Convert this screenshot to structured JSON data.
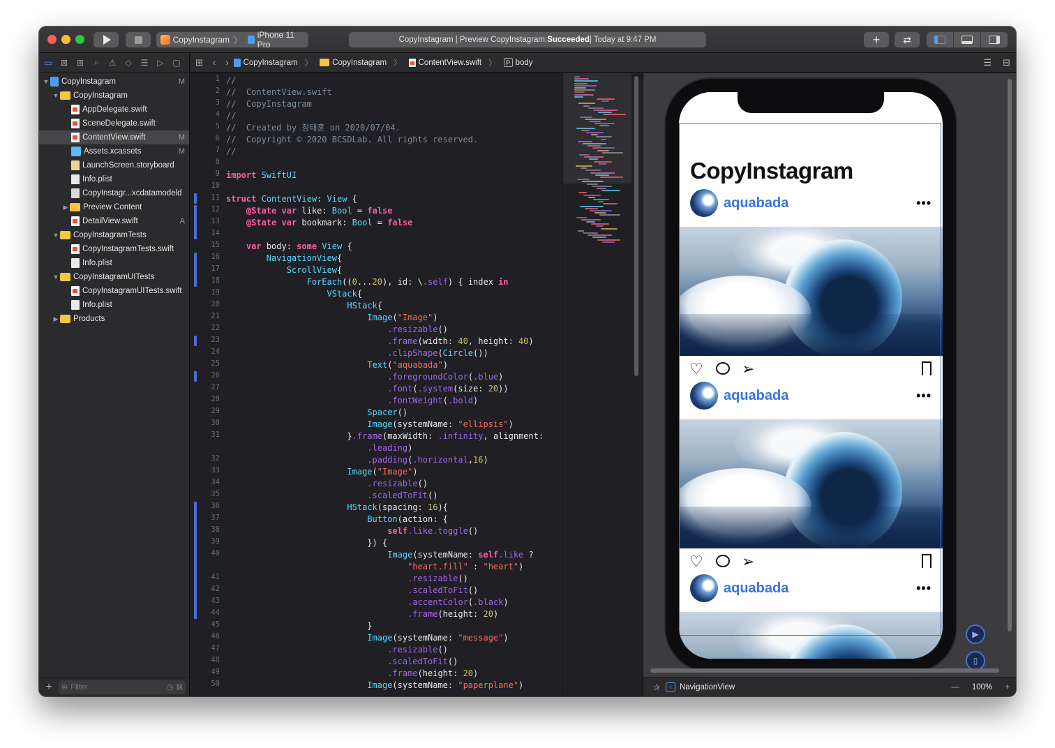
{
  "toolbar": {
    "scheme": "CopyInstagram",
    "device": "iPhone 11 Pro",
    "activity_prefix": "CopyInstagram | Preview CopyInstagram: ",
    "activity_status": "Succeeded",
    "activity_suffix": " | Today at 9:47 PM"
  },
  "navigator": {
    "items": [
      {
        "label": "CopyInstagram",
        "badge": "M"
      },
      {
        "label": "CopyInstagram",
        "badge": ""
      },
      {
        "label": "AppDelegate.swift",
        "badge": ""
      },
      {
        "label": "SceneDelegate.swift",
        "badge": ""
      },
      {
        "label": "ContentView.swift",
        "badge": "M"
      },
      {
        "label": "Assets.xcassets",
        "badge": "M"
      },
      {
        "label": "LaunchScreen.storyboard",
        "badge": ""
      },
      {
        "label": "Info.plist",
        "badge": ""
      },
      {
        "label": "CopyInstagr...xcdatamodeld",
        "badge": ""
      },
      {
        "label": "Preview Content",
        "badge": ""
      },
      {
        "label": "DetailView.swift",
        "badge": "A"
      },
      {
        "label": "CopyInstagramTests",
        "badge": ""
      },
      {
        "label": "CopyInstagramTests.swift",
        "badge": ""
      },
      {
        "label": "Info.plist",
        "badge": ""
      },
      {
        "label": "CopyInstagramUITests",
        "badge": ""
      },
      {
        "label": "CopyInstagramUITests.swift",
        "badge": ""
      },
      {
        "label": "Info.plist",
        "badge": ""
      },
      {
        "label": "Products",
        "badge": ""
      }
    ],
    "filter_placeholder": "Filter"
  },
  "jumpbar": {
    "crumbs": [
      "CopyInstagram",
      "CopyInstagram",
      "ContentView.swift",
      "body"
    ],
    "symbol_glyph": "P"
  },
  "editor": {
    "line_numbers": [
      "1",
      "2",
      "3",
      "4",
      "5",
      "6",
      "7",
      "8",
      "9",
      "10",
      "11",
      "12",
      "13",
      "14",
      "15",
      "16",
      "17",
      "18",
      "19",
      "20",
      "21",
      "22",
      "23",
      "24",
      "25",
      "26",
      "27",
      "28",
      "29",
      "30",
      "31",
      "",
      "32",
      "33",
      "34",
      "35",
      "36",
      "37",
      "38",
      "39",
      "40",
      "",
      "41",
      "42",
      "43",
      "44",
      "45",
      "46",
      "47",
      "48",
      "49",
      "50"
    ],
    "lines": [
      "//",
      "//  ContentView.swift",
      "//  CopyInstagram",
      "//",
      "//  Created by 정태훈 on 2020/07/04.",
      "//  Copyright © 2020 BCSDLab. All rights reserved.",
      "//",
      "",
      "import SwiftUI",
      "",
      "struct ContentView: View {",
      "    @State var like: Bool = false",
      "    @State var bookmark: Bool = false",
      "",
      "    var body: some View {",
      "        NavigationView{",
      "            ScrollView{",
      "                ForEach((0...20), id: \\.self) { index in",
      "                    VStack{",
      "                        HStack{",
      "                            Image(\"Image\")",
      "                                .resizable()",
      "                                .frame(width: 40, height: 40)",
      "                                .clipShape(Circle())",
      "                            Text(\"aquabada\")",
      "                                .foregroundColor(.blue)",
      "                                .font(.system(size: 20))",
      "                                .fontWeight(.bold)",
      "                            Spacer()",
      "                            Image(systemName: \"ellipsis\")",
      "                        }.frame(maxWidth: .infinity, alignment:",
      "                            .leading)",
      "                            .padding(.horizontal,16)",
      "                        Image(\"Image\")",
      "                            .resizable()",
      "                            .scaledToFit()",
      "                        HStack(spacing: 16){",
      "                            Button(action: {",
      "                                self.like.toggle()",
      "                            }) {",
      "                                Image(systemName: self.like ?",
      "                                    \"heart.fill\" : \"heart\")",
      "                                    .resizable()",
      "                                    .scaledToFit()",
      "                                    .accentColor(.black)",
      "                                    .frame(height: 20)",
      "                            }",
      "                            Image(systemName: \"message\")",
      "                                .resizable()",
      "                                .scaledToFit()",
      "                                .frame(height: 20)",
      "                            Image(systemName: \"paperplane\")"
    ]
  },
  "preview": {
    "nav_title": "CopyInstagram",
    "username": "aquabada",
    "more_glyph": "•••"
  },
  "canvas_bar": {
    "selection": "NavigationView",
    "zoom": "100%"
  }
}
